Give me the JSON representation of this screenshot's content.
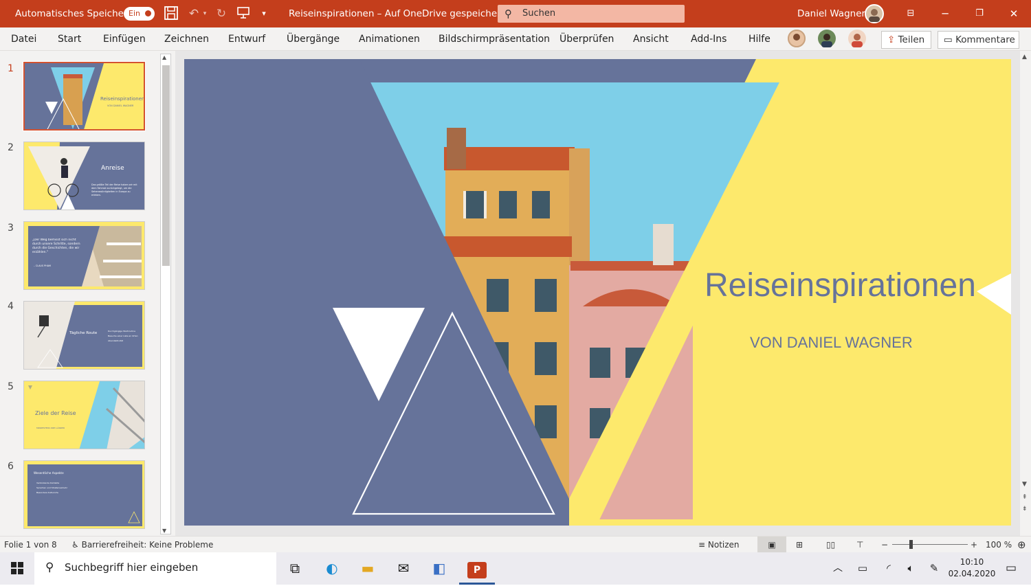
{
  "titlebar": {
    "autosave_label": "Automatisches Speichern",
    "autosave_state": "Ein",
    "document_title": "Reiseinspirationen – Auf OneDrive gespeichert",
    "search_label": "Suchen",
    "user_name": "Daniel Wagner",
    "color": "#c43e1c"
  },
  "menu": {
    "items": [
      "Datei",
      "Start",
      "Einfügen",
      "Zeichnen",
      "Entwurf",
      "Übergänge",
      "Animationen",
      "Bildschirmpräsentation",
      "Überprüfen",
      "Ansicht",
      "Add-Ins",
      "Hilfe"
    ],
    "share_label": "Teilen",
    "comments_label": "Kommentare"
  },
  "slides": {
    "numbers": [
      "1",
      "2",
      "3",
      "4",
      "5",
      "6"
    ],
    "thumbs": [
      {
        "title": "Reiseinspirationen",
        "subtitle": "VON DANIEL WAGNER"
      },
      {
        "title": "Anreise",
        "body": "Das größte Teil der Reise haben wir mit dem Fahrrad zurückgelegt, um die Sehenswürdigkeiten in Europa zu erleben."
      },
      {
        "quote": "„Der Weg bemisst sich nicht durch unsere Schritte, sondern durch die Geschichten, die wir erzählen.\"",
        "author": "– CLAUS PHAM"
      },
      {
        "title": "Tägliche Route",
        "bullets": [
          "Durchgängige Startroutine",
          "Besuche einer Liste an Orten",
          "Abendaktivität"
        ]
      },
      {
        "title": "Ziele der Reise",
        "subtitle": "MINDESTENS DREI LÄNDER"
      },
      {
        "title": "Wesentliche Aspekte",
        "bullets": [
          "Verbindende Kontakte",
          "Sprachen und Straßenverkehr",
          "Besondere Kulturorte"
        ]
      }
    ]
  },
  "main_slide": {
    "title": "Reiseinspirationen",
    "subtitle": "VON DANIEL WAGNER",
    "colors": {
      "blue": "#66739a",
      "yellow": "#fde96c",
      "sky": "#7ecfe8"
    }
  },
  "status": {
    "slide_info": "Folie 1 von 8",
    "accessibility": "Barrierefreiheit: Keine Probleme",
    "notes_label": "Notizen",
    "zoom": "100 %"
  },
  "taskbar": {
    "search_placeholder": "Suchbegriff hier eingeben",
    "time": "10:10",
    "date": "02.04.2020"
  }
}
